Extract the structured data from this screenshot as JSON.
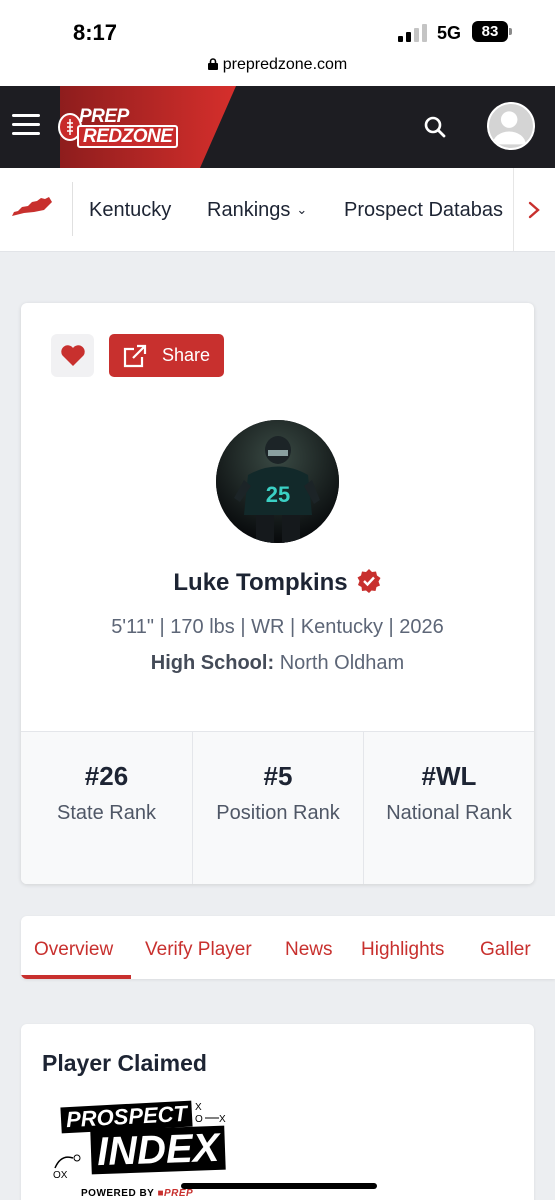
{
  "status_bar": {
    "time": "8:17",
    "network": "5G",
    "battery": "83",
    "url": "prepredzone.com"
  },
  "header": {
    "logo_line1": "PREP",
    "logo_line2": "REDZONE",
    "menu_icon": "hamburger-icon",
    "search_icon": "search-icon",
    "avatar_icon": "user-avatar-icon"
  },
  "subnav": {
    "state_icon": "kentucky-state-icon",
    "items": [
      {
        "label": "Kentucky"
      },
      {
        "label": "Rankings"
      },
      {
        "label": "Prospect Databas"
      }
    ]
  },
  "profile": {
    "share_label": "Share",
    "name": "Luke Tompkins",
    "meta": "5'11\" | 170 lbs | WR | Kentucky | 2026",
    "school_label": "High School:",
    "school_value": "North Oldham",
    "jersey_number": "25",
    "ranks": [
      {
        "value": "#26",
        "label": "State Rank"
      },
      {
        "value": "#5",
        "label": "Position Rank"
      },
      {
        "value": "#WL",
        "label": "National Rank"
      }
    ]
  },
  "tabs": {
    "items": [
      {
        "label": "Overview"
      },
      {
        "label": "Verify Player"
      },
      {
        "label": "News"
      },
      {
        "label": "Highlights"
      },
      {
        "label": "Galler"
      }
    ],
    "active": "Overview"
  },
  "claimed": {
    "title": "Player Claimed",
    "logo_word1": "PROSPECT",
    "logo_word2": "INDEX",
    "logo_powered": "POWERED BY"
  },
  "colors": {
    "brand_red": "#c8302e",
    "header_dark": "#1d1d22",
    "page_bg": "#eceef1"
  }
}
